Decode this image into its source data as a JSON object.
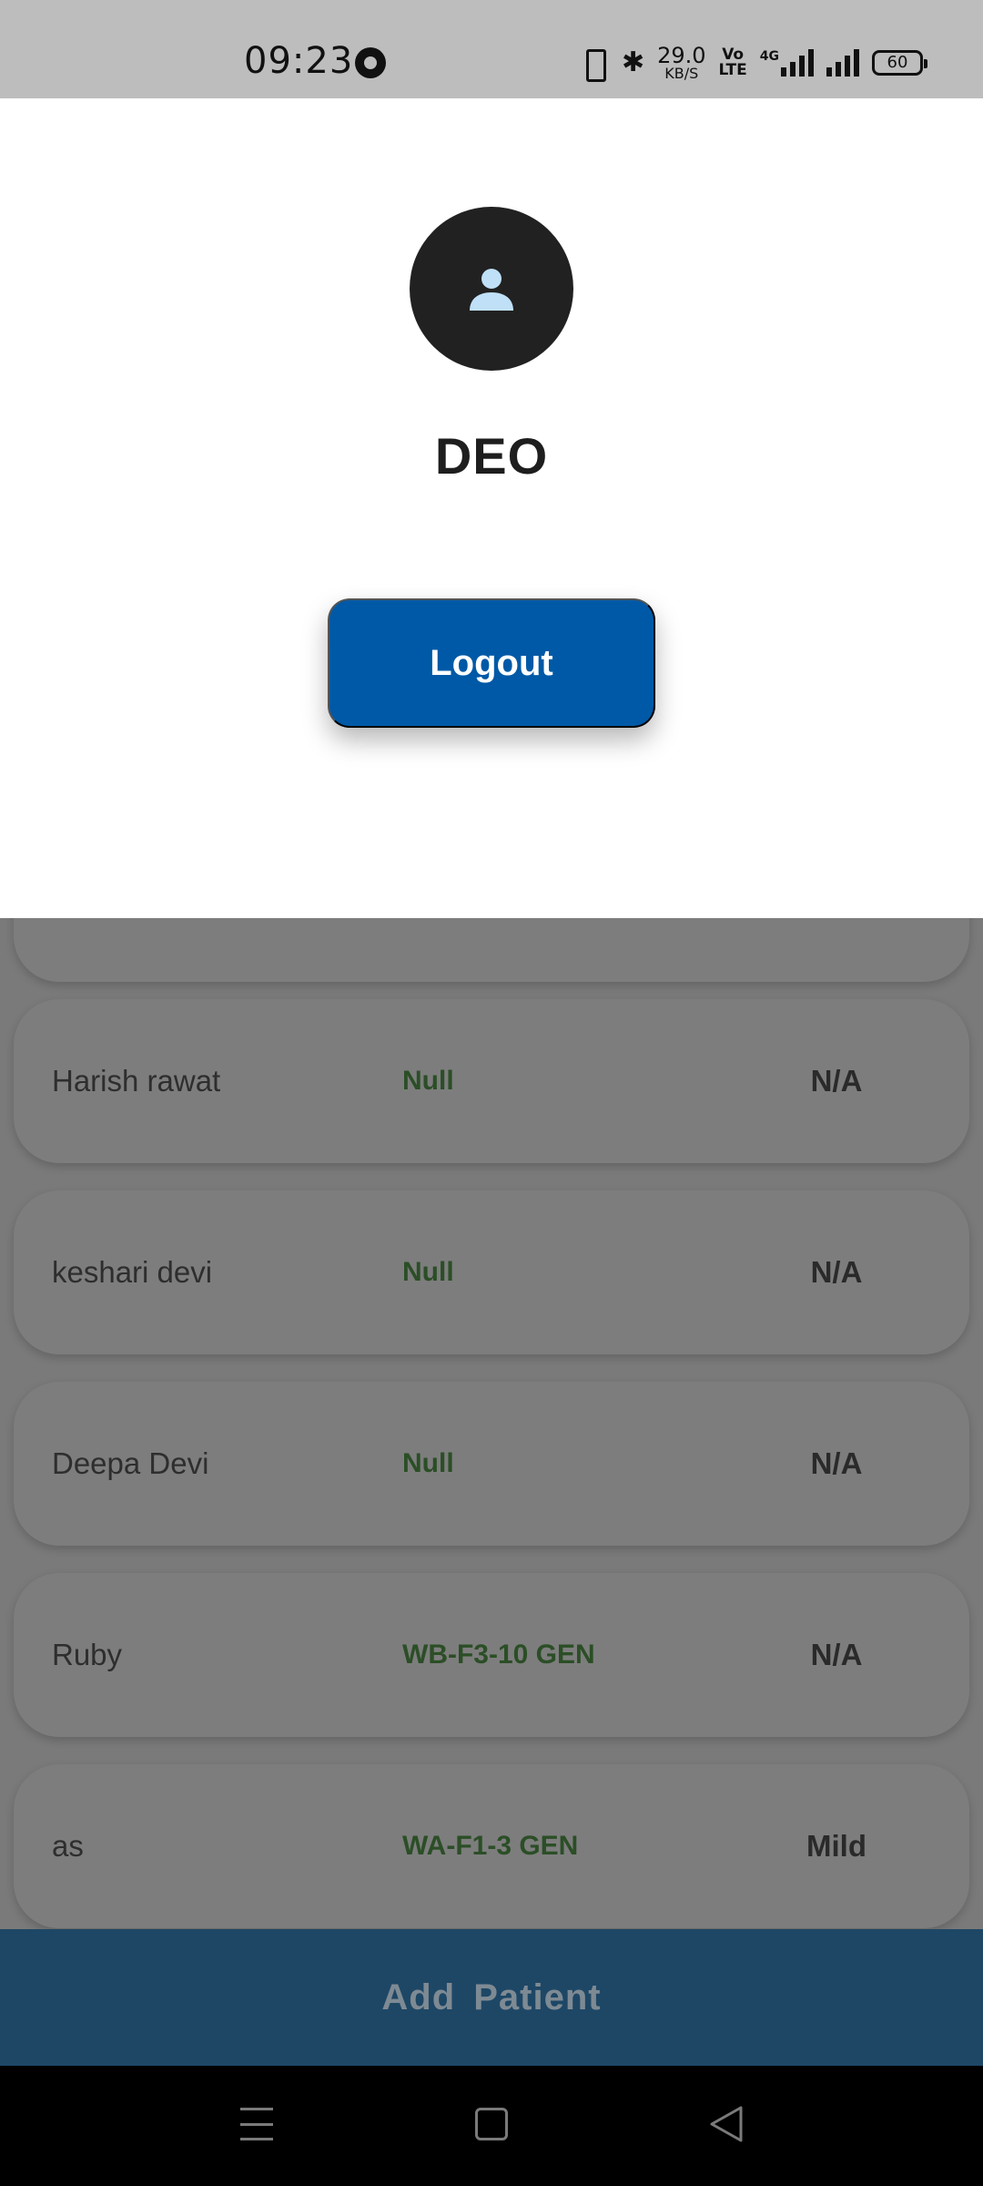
{
  "status_bar": {
    "time": "09:23",
    "net_speed_value": "29.0",
    "net_speed_unit": "KB/S",
    "volte_top": "Vo",
    "volte_bottom": "LTE",
    "network_type": "4G",
    "battery_level": "60"
  },
  "profile": {
    "name": "DEO",
    "avatar_icon": "person-icon",
    "logout_label": "Logout"
  },
  "patients": {
    "rows": [
      {
        "name": "",
        "code": "",
        "severity": ""
      },
      {
        "name": "Harish rawat",
        "code": "Null",
        "severity": "N/A"
      },
      {
        "name": "keshari devi",
        "code": "Null",
        "severity": "N/A"
      },
      {
        "name": "Deepa Devi",
        "code": "Null",
        "severity": "N/A"
      },
      {
        "name": "Ruby",
        "code": "WB-F3-10 GEN",
        "severity": "N/A"
      },
      {
        "name": "as",
        "code": "WA-F1-3 GEN",
        "severity": "Mild"
      }
    ]
  },
  "add_patient": {
    "label": "Add  Patient"
  },
  "colors": {
    "accent": "#0059a6",
    "avatar_bg": "#212121",
    "avatar_icon": "#bfe0f7",
    "code_text": "#2b4e26",
    "add_patient_bar": "#1e4766"
  }
}
